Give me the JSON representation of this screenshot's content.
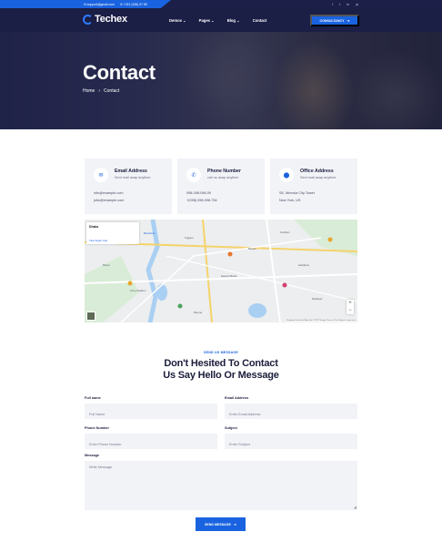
{
  "topbar": {
    "email": "support@gmail.com",
    "phone": "+012 (345) 67 89",
    "social": [
      "f",
      "t",
      "in",
      "yt"
    ]
  },
  "nav": {
    "logo": "Techex",
    "menu": [
      "Demos",
      "Pages",
      "Blog",
      "Contact"
    ],
    "cta": "CONSULTANCY"
  },
  "hero": {
    "title": "Contact",
    "breadcrumb": {
      "home": "Home",
      "sep": "›",
      "current": "Contact"
    }
  },
  "cards": [
    {
      "title": "Email Address",
      "sub": "Sent mail asap anytime",
      "line1": "info@example.com",
      "line2": "jobs@example.com",
      "icon": "mail-icon"
    },
    {
      "title": "Phone Number",
      "sub": "call us asap anytime",
      "line1": "098-098-098-09",
      "line2": "+(098) 098-098-754",
      "icon": "phone-icon"
    },
    {
      "title": "Office Address",
      "sub": "Sent mail asap anytime",
      "line1": "SE, Minnsla City Tower",
      "line2": "New York, US",
      "icon": "location-pin-icon"
    }
  ],
  "map": {
    "place": "Dhaka",
    "view_larger": "View larger map",
    "directions": "Directions",
    "labels": [
      "Tejgaon",
      "Gulshan",
      "Banani",
      "Army Stadium",
      "Mirpur",
      "Ramna",
      "Hatirjheel",
      "Kawran Bazar",
      "Motijheel"
    ],
    "footer": "Keyboard shortcuts   Map data ©2022 Google   Terms of Use   Report a map error"
  },
  "form": {
    "eyebrow": "SEND US MESSAGE",
    "heading_line1": "Don't Hesited To Contact",
    "heading_line2": "Us Say Hello Or Message",
    "fields": {
      "full_name": {
        "label": "Full name",
        "placeholder": "Full Name"
      },
      "email": {
        "label": "Email Address",
        "placeholder": "Enter Email Address"
      },
      "phone": {
        "label": "Phone Number",
        "placeholder": "Enter Phone Number"
      },
      "subject": {
        "label": "Subject",
        "placeholder": "Enter Subject"
      },
      "message": {
        "label": "Message",
        "placeholder": "Write Message"
      }
    },
    "submit": "SEND MESSAGE"
  },
  "colors": {
    "accent": "#1a63e0",
    "navy": "#1b1e45",
    "card_bg": "#f1f3f7"
  }
}
